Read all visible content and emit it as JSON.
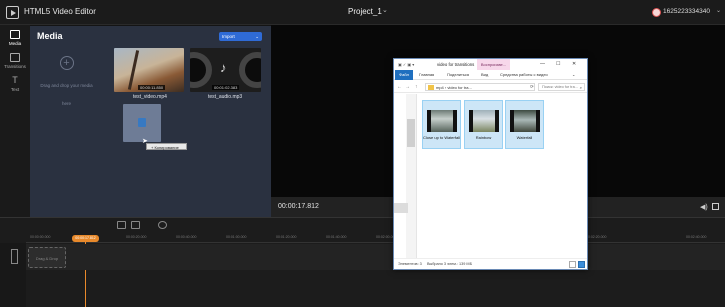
{
  "header": {
    "app_title": "HTML5 Video Editor",
    "project_title": "Project_1",
    "project_chevron": "⌄",
    "user_id": "1625223334340",
    "user_chevron": "⌄"
  },
  "rail": {
    "items": [
      {
        "label": "Media",
        "icon": "media-icon"
      },
      {
        "label": "Transitions",
        "icon": "transitions-icon"
      },
      {
        "label": "Text",
        "icon": "text-icon"
      }
    ]
  },
  "media": {
    "title": "Media",
    "import_label": "Import",
    "import_chevron": "⌄",
    "drop_text": "Drag and drop your media here",
    "items": [
      {
        "name": "test_video.mp4",
        "duration": "00:00:11.850"
      },
      {
        "name": "test_audio.mp3",
        "duration": "00:01:02.383"
      }
    ],
    "copy_tip": "+ Копирование"
  },
  "preview": {
    "time": "00:00:17.812",
    "volume_icon": "◀)"
  },
  "timeline": {
    "playhead_time": "00:00:17.812",
    "drop_clip_label": "Drag & Drop",
    "ticks": [
      "00:00:00.000",
      "00:00:20.000",
      "00:00:40.000",
      "00:01:00.000",
      "00:01:20.000",
      "00:01:40.000",
      "00:02:00.000",
      "00:02:20.000",
      "00:02:40.000"
    ]
  },
  "explorer": {
    "qat": "▣ ✓ ▣ ▾",
    "title": "video for transitions",
    "contextual_tab": "Воспроизве...",
    "window_buttons": {
      "min": "—",
      "max": "☐",
      "close": "✕"
    },
    "ribbon_tabs": [
      "Файл",
      "Главная",
      "Поделиться",
      "Вид",
      "Средства работы с видео"
    ],
    "path": "mp4 › video for tra...",
    "search_placeholder": "Поиск: video for tra...",
    "search_icon": "⌕",
    "nav_buttons": [
      "←",
      "→",
      "↑",
      "⟳"
    ],
    "files": [
      {
        "name": "Close up to Waterfall"
      },
      {
        "name": "Rainbow"
      },
      {
        "name": "Waterfall"
      }
    ],
    "status_count": "Элементов: 3",
    "status_selection": "Выбрано 3 элем.: 139 МБ"
  },
  "colors": {
    "accent": "#2f6bd6",
    "playhead": "#e8892b",
    "panel": "#2a3140"
  }
}
